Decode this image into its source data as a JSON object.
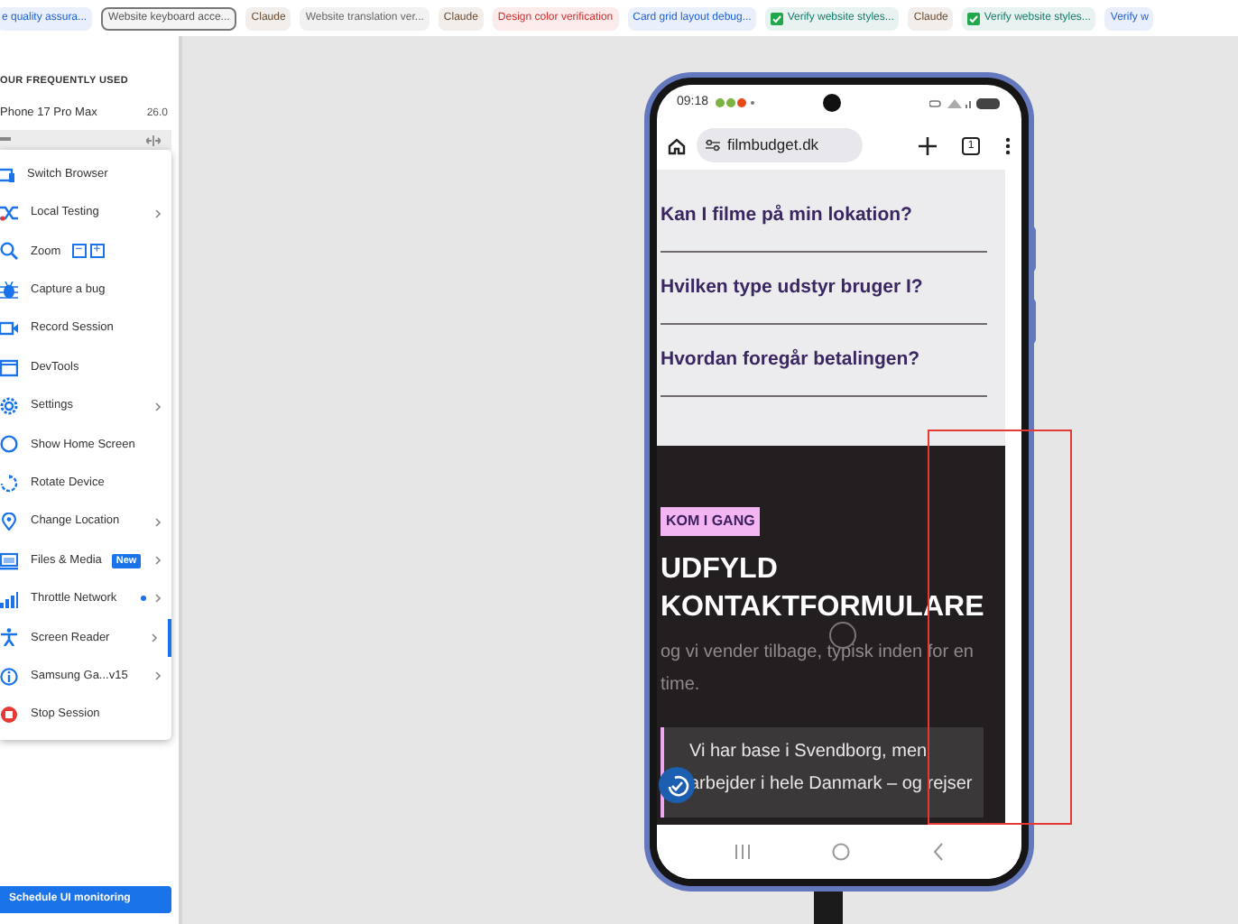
{
  "chips": [
    {
      "label": "e quality assura...",
      "color": "#1d5fd6",
      "selected": false,
      "checked": false
    },
    {
      "label": "Website keyboard acce...",
      "color": "#555555",
      "selected": true,
      "checked": false
    },
    {
      "label": "Claude",
      "color": "#6b4a2e",
      "selected": false,
      "checked": false
    },
    {
      "label": "Website translation ver...",
      "color": "#666666",
      "selected": false,
      "checked": false
    },
    {
      "label": "Claude",
      "color": "#6b4a2e",
      "selected": false,
      "checked": false
    },
    {
      "label": "Design color verification",
      "color": "#d32f2f",
      "selected": false,
      "checked": false
    },
    {
      "label": "Card grid layout debug...",
      "color": "#1d5fd6",
      "selected": false,
      "checked": false
    },
    {
      "label": "Verify website styles...",
      "color": "#0e7c6b",
      "selected": false,
      "checked": true
    },
    {
      "label": "Claude",
      "color": "#6b4a2e",
      "selected": false,
      "checked": false
    },
    {
      "label": "Verify website styles...",
      "color": "#0e7c6b",
      "selected": false,
      "checked": true
    },
    {
      "label": "Verify w",
      "color": "#1d5fd6",
      "selected": false,
      "checked": false
    }
  ],
  "sidebar": {
    "heading": "OUR FREQUENTLY USED",
    "device": {
      "name": "Phone 17 Pro Max",
      "version": "26.0"
    },
    "menu": [
      {
        "kind": "plain",
        "label": "Switch Browser",
        "chevron": false,
        "selected": false
      },
      {
        "kind": "plain",
        "label": "Local Testing",
        "chevron": true,
        "selected": false
      },
      {
        "kind": "zoom",
        "label": "Zoom",
        "minus": "−",
        "plus": "+",
        "chevron": false,
        "selected": false
      },
      {
        "kind": "plain",
        "label": "Capture a bug",
        "chevron": false,
        "selected": false
      },
      {
        "kind": "plain",
        "label": "Record Session",
        "chevron": false,
        "selected": false
      },
      {
        "kind": "plain",
        "label": "DevTools",
        "chevron": false,
        "selected": false
      },
      {
        "kind": "plain",
        "label": "Settings",
        "chevron": true,
        "selected": false
      },
      {
        "kind": "plain",
        "label": "Show Home Screen",
        "chevron": false,
        "selected": false
      },
      {
        "kind": "plain",
        "label": "Rotate Device",
        "chevron": false,
        "selected": false
      },
      {
        "kind": "plain",
        "label": "Change Location",
        "chevron": true,
        "selected": false
      },
      {
        "kind": "badge",
        "label": "Files & Media",
        "badge": "New",
        "chevron": true,
        "selected": false
      },
      {
        "kind": "dot",
        "label": "Throttle Network",
        "chevron": true,
        "selected": false
      },
      {
        "kind": "plain",
        "label": "Screen Reader",
        "chevron": true,
        "selected": true
      },
      {
        "kind": "plain",
        "label": "Samsung Ga...v15",
        "chevron": true,
        "selected": false
      },
      {
        "kind": "plain",
        "label": "Stop Session",
        "chevron": false,
        "selected": false
      }
    ],
    "action": "Schedule UI monitoring"
  },
  "phone": {
    "time": "09:18",
    "url": "filmbudget.dk",
    "tab_count": "1",
    "questions": [
      "Kan I filme på min lokation?",
      "Hvilken type udstyr bruger I?",
      "Hvordan foregår betalingen?"
    ],
    "badge": "KOM I GANG",
    "heading": [
      "UDFYLD",
      "KONTAKTFORMULARE"
    ],
    "paragraph": "og vi vender tilbage, typisk inden for en time.",
    "quote": [
      "Vi har base i Svendborg, men",
      "arbejder i hele Danmark – og rejser"
    ]
  }
}
